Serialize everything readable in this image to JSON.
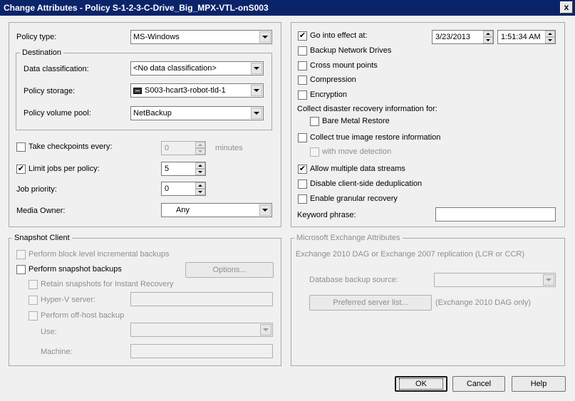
{
  "window": {
    "title": "Change Attributes - Policy S-1-2-3-C-Drive_Big_MPX-VTL-onS003",
    "close_label": "x"
  },
  "left": {
    "policy_type": {
      "label": "Policy type:",
      "value": "MS-Windows"
    },
    "destination": {
      "legend": "Destination",
      "data_classification": {
        "label": "Data classification:",
        "value": "<No data classification>"
      },
      "policy_storage": {
        "label": "Policy storage:",
        "value": "S003-hcart3-robot-tld-1",
        "icon": "tape-drive-icon"
      },
      "volume_pool": {
        "label": "Policy volume pool:",
        "value": "NetBackup"
      }
    },
    "checkpoints": {
      "label": "Take checkpoints every:",
      "value": "0",
      "unit": "minutes",
      "checked": false
    },
    "limit_jobs": {
      "label": "Limit jobs per policy:",
      "value": "5",
      "checked": true
    },
    "job_priority": {
      "label": "Job priority:",
      "value": "0"
    },
    "media_owner": {
      "label": "Media Owner:",
      "value": "Any"
    }
  },
  "right": {
    "go_into_effect": {
      "label": "Go into effect at:",
      "checked": true,
      "date": "3/23/2013",
      "time": "1:51:34 AM"
    },
    "backup_network_drives": {
      "label": "Backup Network Drives",
      "checked": false
    },
    "cross_mount_points": {
      "label": "Cross mount points",
      "checked": false
    },
    "compression": {
      "label": "Compression",
      "checked": false
    },
    "encryption": {
      "label": "Encryption",
      "checked": false
    },
    "collect_dr_label": "Collect disaster recovery information for:",
    "bare_metal_restore": {
      "label": "Bare Metal Restore",
      "checked": false
    },
    "true_image_restore": {
      "label": "Collect true image restore information",
      "checked": false
    },
    "move_detection": {
      "label": "with move detection",
      "checked": false
    },
    "multiple_streams": {
      "label": "Allow multiple data streams",
      "checked": true
    },
    "client_dedup": {
      "label": "Disable client-side deduplication",
      "checked": false
    },
    "granular_recovery": {
      "label": "Enable granular recovery",
      "checked": false
    },
    "keyword_phrase": {
      "label": "Keyword phrase:",
      "value": ""
    }
  },
  "snapshot": {
    "legend": "Snapshot Client",
    "block_level": {
      "label": "Perform block level incremental backups",
      "checked": false
    },
    "snapshot_backups": {
      "label": "Perform snapshot backups",
      "checked": false
    },
    "options_button": "Options...",
    "retain_snapshots": {
      "label": "Retain snapshots for Instant Recovery",
      "checked": false
    },
    "hyperv_server": {
      "label": "Hyper-V server:",
      "checked": false,
      "value": ""
    },
    "offhost_backup": {
      "label": "Perform off-host backup",
      "checked": false
    },
    "use": {
      "label": "Use:",
      "value": ""
    },
    "machine": {
      "label": "Machine:",
      "value": ""
    }
  },
  "exchange": {
    "legend": "Microsoft Exchange Attributes",
    "replication_label": "Exchange 2010 DAG or Exchange 2007 replication (LCR or CCR)",
    "db_backup_source": {
      "label": "Database backup source:",
      "value": ""
    },
    "preferred_server_button": "Preferred server list...",
    "dag_only_label": "(Exchange 2010 DAG only)"
  },
  "footer": {
    "ok": "OK",
    "cancel": "Cancel",
    "help": "Help"
  }
}
